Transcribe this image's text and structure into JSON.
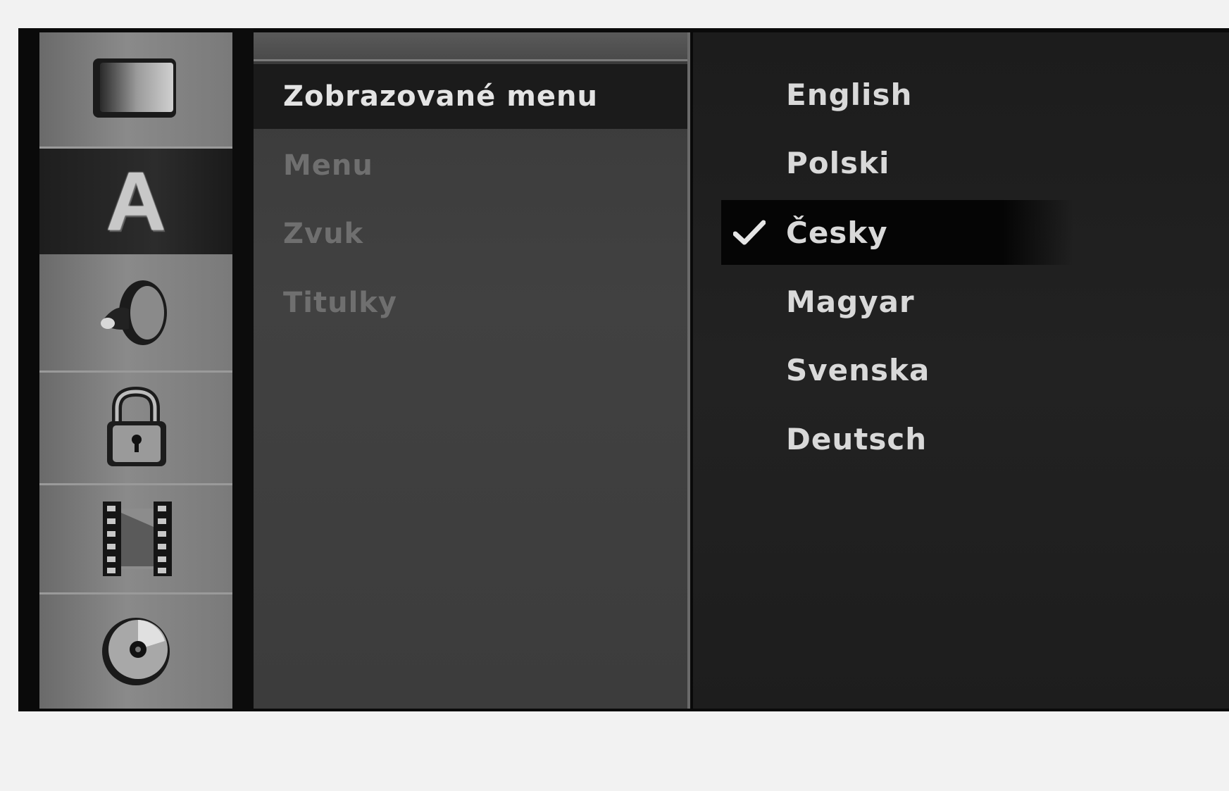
{
  "sidebar": {
    "items": [
      {
        "icon": "tv-screen-icon",
        "active": false
      },
      {
        "icon": "language-letter-a-icon",
        "glyph": "A",
        "active": true
      },
      {
        "icon": "speaker-audio-icon",
        "active": false
      },
      {
        "icon": "lock-icon",
        "active": false
      },
      {
        "icon": "film-strip-icon",
        "active": false
      },
      {
        "icon": "disc-icon",
        "active": false
      }
    ]
  },
  "menu": {
    "items": [
      {
        "label": "Zobrazované menu",
        "active": true
      },
      {
        "label": "Menu",
        "active": false
      },
      {
        "label": "Zvuk",
        "active": false
      },
      {
        "label": "Titulky",
        "active": false
      }
    ]
  },
  "options": {
    "items": [
      {
        "label": "English",
        "selected": false
      },
      {
        "label": "Polski",
        "selected": false
      },
      {
        "label": "Česky",
        "selected": true
      },
      {
        "label": "Magyar",
        "selected": false
      },
      {
        "label": "Svenska",
        "selected": false
      },
      {
        "label": "Deutsch",
        "selected": false
      }
    ]
  },
  "colors": {
    "screen_bg": "#0a0a0a",
    "sidebar_bg": "#7a7a7a",
    "menu_bg": "#3e3e3e",
    "options_bg": "#1f1f1f",
    "text_active": "#e4e4e4",
    "text_inactive": "#6f6f6f"
  }
}
